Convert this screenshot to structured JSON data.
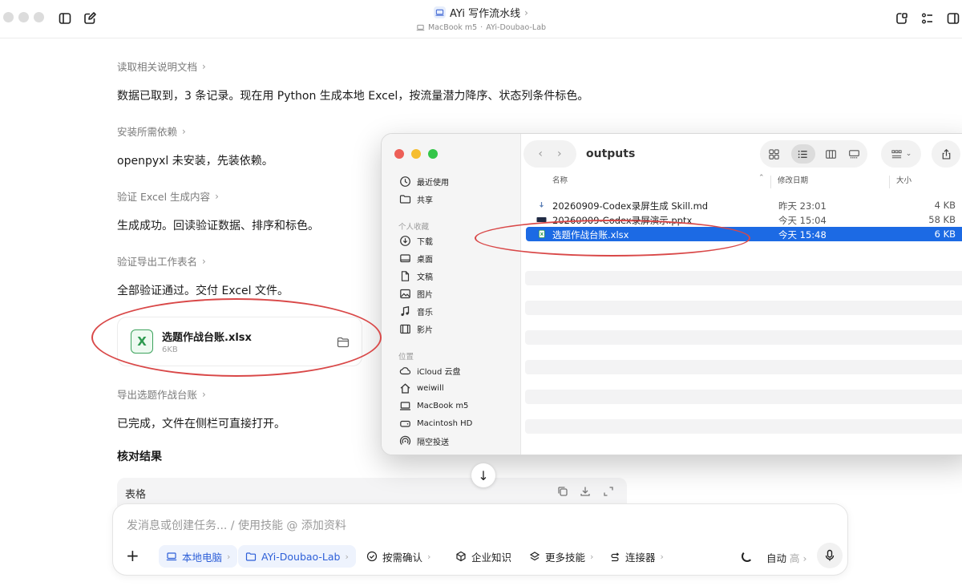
{
  "window": {
    "title": "AYi 写作流水线",
    "device": "MacBook m5",
    "workspace": "AYi-Doubao-Lab"
  },
  "conversation": {
    "steps": [
      {
        "label": "读取相关说明文档",
        "message": "数据已取到，3 条记录。现在用 Python 生成本地 Excel，按流量潜力降序、状态列条件标色。"
      },
      {
        "label": "安装所需依赖",
        "message": "openpyxl 未安装，先装依赖。"
      },
      {
        "label": "验证 Excel 生成内容",
        "message": "生成成功。回读验证数据、排序和标色。"
      },
      {
        "label": "验证导出工作表名",
        "message": "全部验证通过。交付 Excel 文件。"
      },
      {
        "label": "导出选题作战台账",
        "message": "已完成，文件在侧栏可直接打开。"
      }
    ],
    "attachment": {
      "name": "选题作战台账.xlsx",
      "size": "6KB",
      "icon": "excel-file-icon"
    },
    "section_title": "核对结果",
    "table_label": "表格"
  },
  "composer": {
    "placeholder": "发消息或创建任务... / 使用技能 @ 添加资料",
    "chips": {
      "local": "本地电脑",
      "workspace": "AYi-Doubao-Lab",
      "confirm": "按需确认",
      "knowledge": "企业知识",
      "skills": "更多技能",
      "connectors": "连接器"
    },
    "mode": "自动",
    "mode_level": "高"
  },
  "finder": {
    "folder": "outputs",
    "sidebar": {
      "top": [
        "最近使用",
        "共享"
      ],
      "favorites_label": "个人收藏",
      "favorites": [
        "下载",
        "桌面",
        "文稿",
        "图片",
        "音乐",
        "影片"
      ],
      "locations_label": "位置",
      "locations": [
        "iCloud 云盘",
        "weiwill",
        "MacBook  m5",
        "Macintosh HD",
        "隔空投送"
      ]
    },
    "columns": {
      "name": "名称",
      "date": "修改日期",
      "size": "大小"
    },
    "files": [
      {
        "name": "20260909-Codex录屏生成 Skill.md",
        "date": "昨天 23:01",
        "size": "4 KB"
      },
      {
        "name": "20260909-Codex录屏演示.pptx",
        "date": "今天 15:04",
        "size": "58 KB"
      },
      {
        "name": "选题作战台账.xlsx",
        "date": "今天 15:48",
        "size": "6 KB"
      }
    ],
    "selected_index": 2
  },
  "colors": {
    "selection": "#1c6ae4",
    "annotation": "#d94848",
    "accent_chip": "#2d5fd8"
  }
}
